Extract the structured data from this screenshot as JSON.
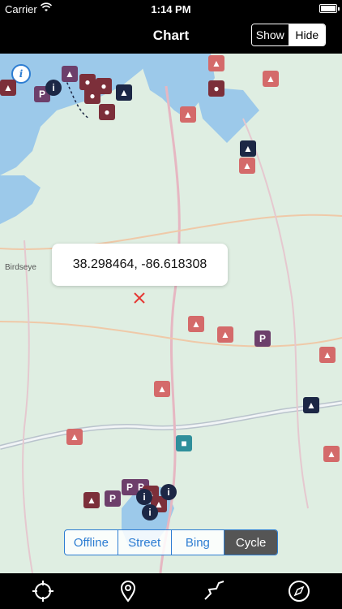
{
  "status_bar": {
    "carrier": "Carrier",
    "time": "1:14 PM"
  },
  "nav": {
    "title": "Chart",
    "show_label": "Show",
    "hide_label": "Hide"
  },
  "map": {
    "coordinates": "38.298464, -86.618308",
    "place_label": "Birdseye",
    "map_types": [
      "Offline",
      "Street",
      "Bing",
      "Cycle"
    ],
    "selected_map_type": "Cycle"
  },
  "markers": {
    "parking": "P",
    "info": "i"
  },
  "tab_bar": {
    "icons": [
      "locate-icon",
      "pin-icon",
      "route-icon",
      "compass-icon"
    ]
  },
  "colors": {
    "accent": "#2d7dd2",
    "water": "#9cc9ea",
    "land": "#dfeee2",
    "road": "#e6b7c2"
  }
}
